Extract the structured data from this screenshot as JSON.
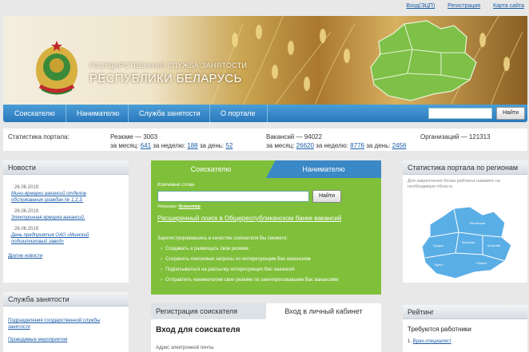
{
  "top_links": {
    "login": "Вход(ЭЦП)",
    "register": "Регистрация",
    "map": "Карта сайта"
  },
  "banner": {
    "line1": "ГОСУДАРСТВЕННАЯ СЛУЖБА ЗАНЯТОСТИ",
    "line2": "РЕСПУБЛИКИ БЕЛАРУСЬ"
  },
  "nav": {
    "items": [
      "Соискателю",
      "Нанимателю",
      "Служба занятости",
      "О портале"
    ],
    "search_button": "Найти"
  },
  "stats": {
    "label": "Статистика портала:",
    "resume_total": "Резюме — 3003",
    "resume_prefix_month": "за месяц:",
    "resume_month": "641",
    "resume_prefix_week": "за неделю:",
    "resume_week": "188",
    "resume_prefix_day": "за день:",
    "resume_day": "52",
    "vac_total": "Вакансий — 94022",
    "vac_prefix_month": "за месяц:",
    "vac_month": "26620",
    "vac_prefix_week": "за неделю:",
    "vac_week": "8776",
    "vac_prefix_day": "за день:",
    "vac_day": "2456",
    "orgs": "Организаций — 121313"
  },
  "news": {
    "title": "Новости",
    "items": [
      {
        "date": "26.06.2019",
        "text1": "Мини-ярмарки вакансий отделов",
        "text2": "обслуживания граждан № 1,2,3."
      },
      {
        "date": "26.06.2019",
        "text1": "Электронная ярмарка вакансий.",
        "text2": ""
      },
      {
        "date": "26.06.2019",
        "text1": "День предприятия ОАО «Минский",
        "text2": "подшипниковый завод»"
      }
    ],
    "all": "Другие новости"
  },
  "service": {
    "title": "Служба занятости",
    "link1a": "Подразделения государственной службы",
    "link1b": "занятости",
    "link2": "Проводимые мероприятия"
  },
  "center": {
    "tab_seeker": "Соискателю",
    "tab_employer": "Нанимателю",
    "keywords_label": "Ключевые слова",
    "find_button": "Найти",
    "example_prefix": "Например:",
    "example_word": "бухгалтер",
    "advanced": "Расширенный поиск в Общереспубликанском банке вакансий",
    "reg_text": "Зарегистрировавшись в качестве соискателя Вы сможете:",
    "features": [
      "Создавать и размещать свои резюме",
      "Сохранять поисковые запросы по интересующим Вас вакансиям",
      "Подписываться на рассылку интересующих Вас вакансий",
      "Отправлять нанимателям свое резюме по заинтересовавшим Вас вакансиям"
    ]
  },
  "login": {
    "tab_reg": "Регистрация соискателя",
    "tab_cab": "Вход в личный кабинет",
    "title": "Вход для соискателя",
    "email_label": "Адрес электронной почты"
  },
  "region": {
    "title": "Статистика портала по регионам",
    "hint1": "Для закрепления блока рейтинга нажмите на",
    "hint2": "необходимую область",
    "labels": [
      "Витебская",
      "Гродно",
      "Минская",
      "Могилёв",
      "Брест",
      "Гомель"
    ]
  },
  "rating": {
    "title": "Рейтинг",
    "sub": "Требуются работники",
    "item1": "Врач-специалист"
  },
  "colors": {
    "nav_blue": "#2a78bd",
    "green": "#7fbf3a",
    "map_blue": "#5aaee6"
  }
}
